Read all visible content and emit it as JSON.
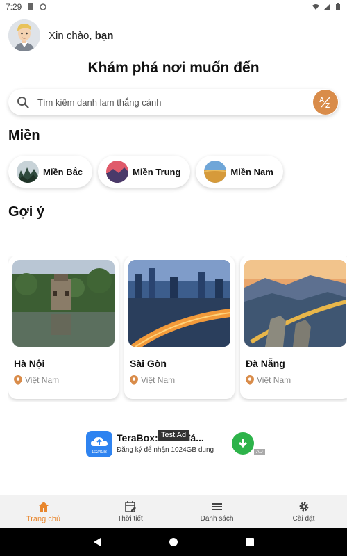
{
  "status_bar": {
    "time": "7:29"
  },
  "header": {
    "greeting_prefix": "Xin chào, ",
    "greeting_name": "bạn"
  },
  "page_title": "Khám phá nơi muốn đến",
  "search": {
    "placeholder": "Tìm kiếm danh lam thắng cảnh",
    "sort_label": "A-Z"
  },
  "regions": {
    "title": "Miền",
    "items": [
      {
        "label": "Miền Bắc"
      },
      {
        "label": "Miền Trung"
      },
      {
        "label": "Miền Nam"
      }
    ]
  },
  "suggestions": {
    "title": "Gợi ý",
    "items": [
      {
        "name": "Hà Nội",
        "country": "Việt Nam"
      },
      {
        "name": "Sài Gòn",
        "country": "Việt Nam"
      },
      {
        "name": "Đà Nẵng",
        "country": "Việt Nam"
      }
    ]
  },
  "ad": {
    "title": "TeraBox: ...ưu đá...",
    "subtitle": "Đăng ký để nhận 1024GB dung",
    "tag": "Test Ad",
    "badge": "AD",
    "logo_text": "1024GB"
  },
  "bottom_nav": {
    "items": [
      {
        "label": "Trang chủ",
        "icon": "home-icon"
      },
      {
        "label": "Thời tiết",
        "icon": "calendar-edit-icon"
      },
      {
        "label": "Danh sách",
        "icon": "list-icon"
      },
      {
        "label": "Cài đặt",
        "icon": "gear-icon"
      }
    ]
  },
  "colors": {
    "accent": "#e8862d",
    "pin": "#d98c4a",
    "ad_blue": "#2e83f0",
    "ad_green": "#2db34a"
  }
}
